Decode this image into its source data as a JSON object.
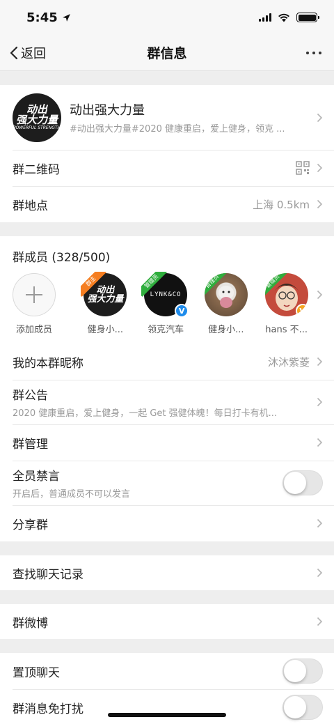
{
  "status_bar": {
    "time": "5:45"
  },
  "nav": {
    "back_label": "返回",
    "title": "群信息"
  },
  "group": {
    "avatar_text_line1": "动出",
    "avatar_text_line2": "强大力量",
    "avatar_text_small": "POWERFUL STRENGTH",
    "name": "动出强大力量",
    "description": "#动出强大力量#2020 健康重启，爱上健身，领克 ..."
  },
  "rows": {
    "qr_label": "群二维码",
    "location_label": "群地点",
    "location_value": "上海 0.5km"
  },
  "members": {
    "title": "群成员 (328/500)",
    "add_label": "添加成员",
    "list": [
      {
        "name": "健身小...",
        "ribbon": "群主",
        "avatar_line1": "动出",
        "avatar_line2": "强大力量",
        "badge": ""
      },
      {
        "name": "领克汽车",
        "ribbon": "管理员",
        "avatar_line1": "LYNK&CO",
        "badge": "V"
      },
      {
        "name": "健身小...",
        "ribbon": "管理员",
        "badge": ""
      },
      {
        "name": "hans 不...",
        "ribbon": "管理员",
        "badge": "V"
      }
    ]
  },
  "settings": {
    "nickname_label": "我的本群昵称",
    "nickname_value": "沐沐紫菱",
    "announcement_label": "群公告",
    "announcement_text": "2020 健康重启，爱上健身，一起 Get 强健体魄！每日打卡有机...",
    "manage_label": "群管理",
    "mute_all_label": "全员禁言",
    "mute_all_sub": "开启后，普通成员不可以发言",
    "mute_all_on": false,
    "share_label": "分享群",
    "search_history_label": "查找聊天记录",
    "weibo_label": "群微博",
    "pin_label": "置顶聊天",
    "pin_on": false,
    "dnd_label": "群消息免打扰",
    "dnd_on": false
  },
  "colors": {
    "owner_ribbon": "#f57e21",
    "admin_ribbon": "#2fae3d",
    "blue_badge": "#1f8ceb",
    "gold_badge": "#f5a623"
  }
}
